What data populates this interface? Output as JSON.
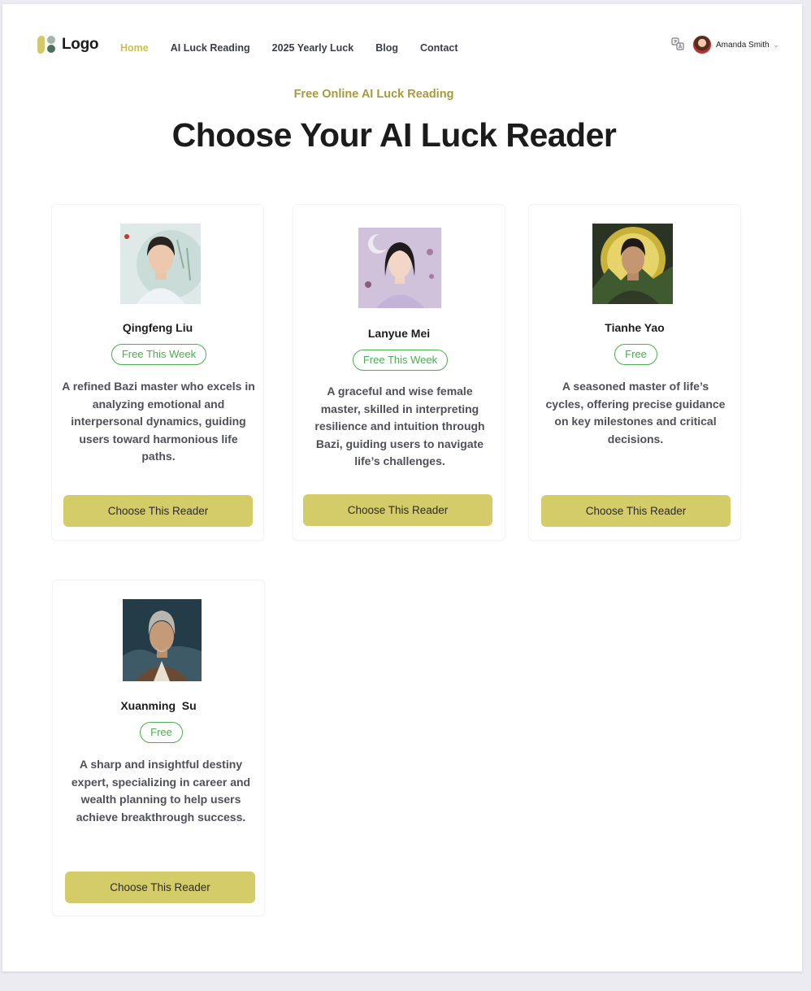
{
  "header": {
    "logo_text": "Logo",
    "nav": [
      {
        "label": "Home",
        "active": true
      },
      {
        "label": "AI Luck Reading",
        "active": false
      },
      {
        "label": "2025 Yearly Luck",
        "active": false
      },
      {
        "label": "Blog",
        "active": false
      },
      {
        "label": "Contact",
        "active": false
      }
    ],
    "user_name": "Amanda Smith",
    "user_chevron": "⌄"
  },
  "hero": {
    "eyebrow": "Free Online AI Luck Reading",
    "title": "Choose Your AI Luck Reader"
  },
  "readers": [
    {
      "name": "Qingfeng Liu",
      "badge": "Free This Week",
      "description": "A refined Bazi master who excels in analyzing emotional and interpersonal dynamics, guiding users toward harmonious life paths.",
      "button": "Choose This Reader"
    },
    {
      "name": "Lanyue Mei",
      "badge": "Free This Week",
      "description": "A graceful and wise female master, skilled in interpreting resilience and intuition through Bazi, guiding users to navigate life’s challenges.",
      "button": "Choose This Reader"
    },
    {
      "name": "Tianhe Yao",
      "badge": "Free",
      "description": "A seasoned master of life’s cycles, offering precise guidance on key milestones and critical decisions.",
      "button": "Choose This Reader"
    },
    {
      "name": "Xuanming  Su",
      "badge": "Free",
      "description": "A sharp and insightful destiny expert, specializing in career and wealth planning to help users achieve breakthrough success.",
      "button": "Choose This Reader"
    }
  ],
  "colors": {
    "accent": "#d4cc68",
    "nav_active": "#cbbf52",
    "eyebrow": "#a69a3a",
    "badge_green": "#4caf50"
  },
  "icons": {
    "translate": "translate-icon",
    "avatar": "user-avatar"
  }
}
